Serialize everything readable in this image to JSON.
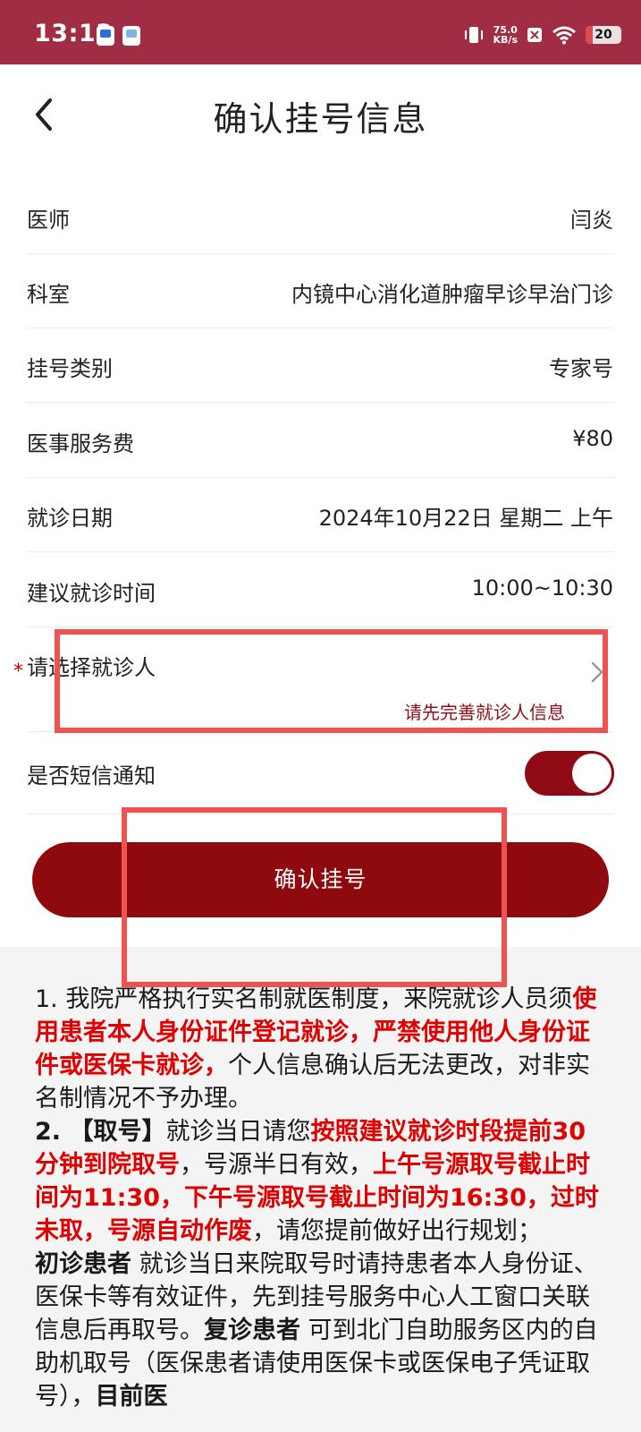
{
  "status_bar": {
    "time": "13:13",
    "net_speed_value": "75.0",
    "net_speed_unit": "KB/s",
    "battery": "20",
    "battery_level": 0.2
  },
  "header": {
    "title": "确认挂号信息"
  },
  "details": [
    {
      "label": "医师",
      "value": "闫炎"
    },
    {
      "label": "科室",
      "value": "内镜中心消化道肿瘤早诊早治门诊"
    },
    {
      "label": "挂号类别",
      "value": "专家号"
    },
    {
      "label": "医事服务费",
      "value": "¥80"
    },
    {
      "label": "就诊日期",
      "value": "2024年10月22日 星期二 上午"
    },
    {
      "label": "建议就诊时间",
      "value": "10:00~10:30"
    }
  ],
  "patient_select": {
    "required_mark": "*",
    "label": "请选择就诊人",
    "hint": "请先完善就诊人信息"
  },
  "sms_notify": {
    "label": "是否短信通知",
    "enabled": true
  },
  "confirm_button": {
    "label": "确认挂号"
  },
  "notice": {
    "p1_a": "1. 我院严格执行实名制就医制度，来院就诊人员须",
    "p1_b": "使用患者本人身份证件登记就诊，严禁使用他人身份证件或医保卡就诊，",
    "p1_c": "个人信息确认后无法更改，对非实名制情况不予办理。",
    "p2_a": "2. 【取号】",
    "p2_b": "就诊当日请您",
    "p2_c": "按照建议就诊时段提前30分钟到院取号",
    "p2_d": "，号源半日有效，",
    "p2_e": "上午号源取号截止时间为11:30，下午号源取号截止时间为16:30，过时未取，号源自动作废",
    "p2_f": "，请您提前做好出行规划；",
    "p3_a": "初诊患者",
    "p3_b": " 就诊当日来院取号时请持患者本人身份证、医保卡等有效证件，先到挂号服务中心人工窗口关联信息后再取号。",
    "p3_c": "复诊患者",
    "p3_d": " 可到北门自助服务区内的自助机取号（医保患者请使用医保卡或医保电子凭证取号），",
    "p3_e": "目前医"
  },
  "colors": {
    "brand": "#a12d45",
    "button": "#8f0a0f",
    "alert_red": "#e00000",
    "annotation": "#f05252"
  }
}
